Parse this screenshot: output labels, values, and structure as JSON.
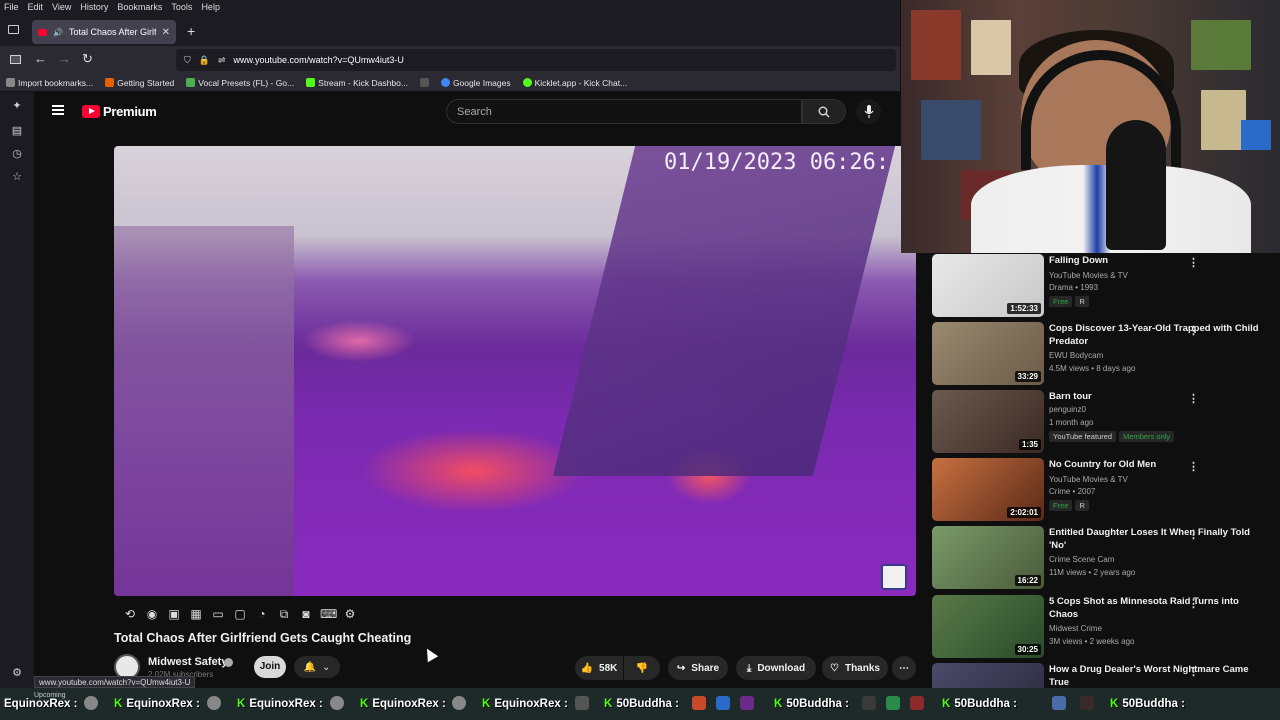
{
  "browser": {
    "menu": [
      "File",
      "Edit",
      "View",
      "History",
      "Bookmarks",
      "Tools",
      "Help"
    ],
    "tab_title": "Total Chaos After Girlfriend",
    "url": "www.youtube.com/watch?v=QUmw4iut3-U",
    "bookmarks": [
      {
        "label": "Import bookmarks...",
        "color": "#888888"
      },
      {
        "label": "Getting Started",
        "color": "#e66000"
      },
      {
        "label": "Vocal Presets (FL) - Go...",
        "color": "#4caf50"
      },
      {
        "label": "Stream - Kick Dashbo...",
        "color": "#53fc18"
      },
      {
        "label": "Google Images",
        "color": "#4285f4"
      },
      {
        "label": "Kicklet.app - Kick Chat...",
        "color": "#53fc18"
      }
    ],
    "status_url": "www.youtube.com/watch?v=QUmw4iut3-U"
  },
  "youtube": {
    "logo_text": "Premium",
    "search_placeholder": "Search"
  },
  "video": {
    "timestamp": "01/19/2023 06:26:",
    "title": "Total Chaos After Girlfriend Gets Caught Cheating",
    "channel": "Midwest Safety",
    "subscribers": "2.02M subscribers",
    "join_label": "Join",
    "likes": "58K",
    "share_label": "Share",
    "download_label": "Download",
    "thanks_label": "Thanks"
  },
  "recommendations": [
    {
      "title": "Falling Down",
      "meta1": "YouTube Movies & TV",
      "meta2": "Drama • 1993",
      "tags": [
        "Free",
        "R"
      ],
      "duration": "1:52:33",
      "thumb": "#d8d8d8"
    },
    {
      "title": "Cops Discover 13-Year-Old Trapped with Child Predator",
      "meta1": "EWU Bodycam",
      "meta2": "4.5M views • 8 days ago",
      "tags": [],
      "duration": "33:29",
      "thumb": "#8a7a60"
    },
    {
      "title": "Barn tour",
      "meta1": "penguinz0",
      "meta2": "1 month ago",
      "tags": [
        "YouTube featured",
        "Members only"
      ],
      "duration": "1:35",
      "thumb": "#5a4a40"
    },
    {
      "title": "No Country for Old Men",
      "meta1": "YouTube Movies & TV",
      "meta2": "Crime • 2007",
      "tags": [
        "Free",
        "R"
      ],
      "duration": "2:02:01",
      "thumb": "#b06030"
    },
    {
      "title": "Entitled Daughter Loses It When Finally Told 'No'",
      "meta1": "Crime Scene Cam",
      "meta2": "11M views • 2 years ago",
      "tags": [],
      "duration": "16:22",
      "thumb": "#6a8a5a"
    },
    {
      "title": "5 Cops Shot as Minnesota Raid Turns into Chaos",
      "meta1": "Midwest Crime",
      "meta2": "3M views • 2 weeks ago",
      "tags": [],
      "duration": "30:25",
      "thumb": "#4a6a3a"
    },
    {
      "title": "How a Drug Dealer's Worst Nightmare Came True",
      "meta1": "",
      "meta2": "",
      "tags": [],
      "duration": "",
      "thumb": "#3a3a5a"
    }
  ],
  "taskbar": {
    "upcoming_label": "Upcoming",
    "tickers": [
      "EquinoxRex :",
      "EquinoxRex :",
      "EquinoxRex :",
      "EquinoxRex :",
      "EquinoxRex :",
      "50Buddha :",
      "50Buddha :",
      "50Buddha :",
      "50Buddha :"
    ]
  }
}
